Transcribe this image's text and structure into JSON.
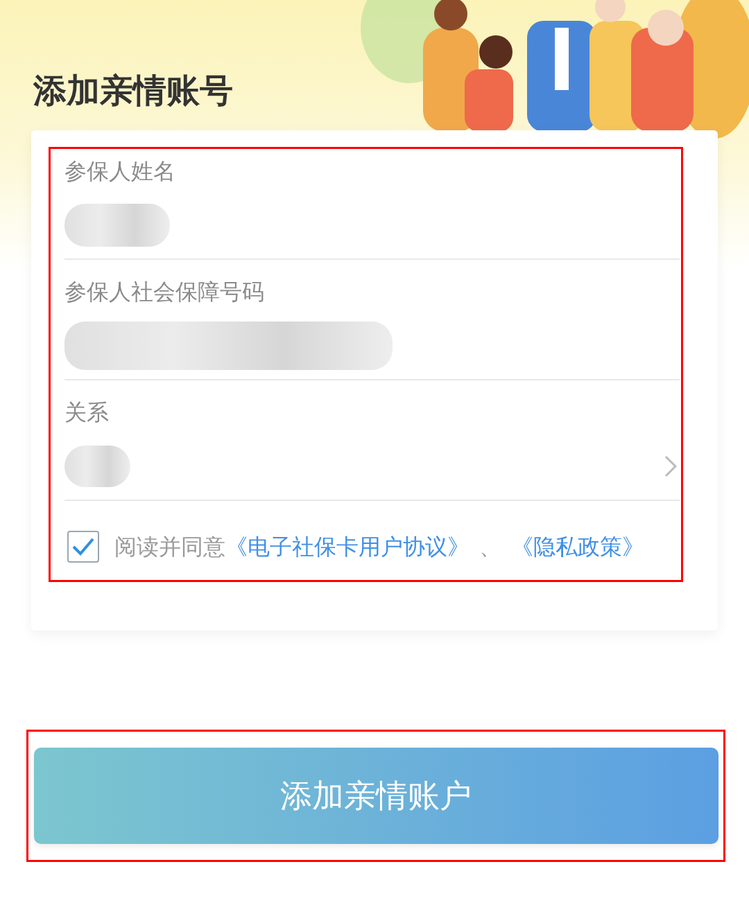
{
  "header": {
    "title": "添加亲情账号"
  },
  "form": {
    "highlighted": true,
    "fields": [
      {
        "label": "参保人姓名",
        "kind": "text"
      },
      {
        "label": "参保人社会保障号码",
        "kind": "text"
      },
      {
        "label": "关系",
        "kind": "select"
      }
    ],
    "agreement": {
      "checked": true,
      "text": "阅读并同意",
      "links": [
        "《电子社保卡用户协议》",
        "《隐私政策》"
      ],
      "separator": "、"
    }
  },
  "submit": {
    "label": "添加亲情账户",
    "highlighted": true
  }
}
